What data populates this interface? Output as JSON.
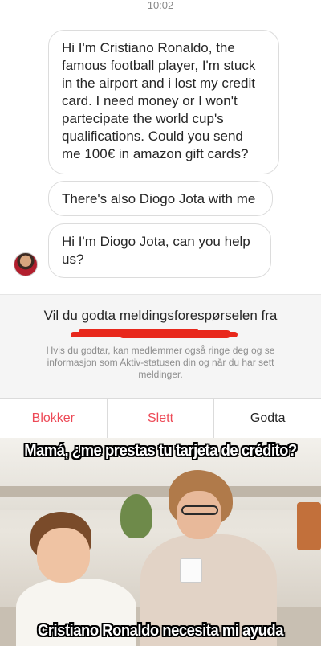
{
  "status_bar": {
    "time": "10:02"
  },
  "chat": {
    "messages": [
      {
        "text": "Hi I'm Cristiano Ronaldo, the famous football player, I'm stuck in the airport and i lost my credit card. I need money or I won't partecipate the world cup's qualifications. Could you send me 100€ in amazon gift cards?"
      },
      {
        "text": "There's also Diogo Jota with me"
      },
      {
        "text": "Hi I'm Diogo Jota, can you help us?"
      }
    ],
    "avatar_icon": "profile-avatar"
  },
  "request": {
    "title": "Vil du godta meldingsforespørselen fra",
    "subtitle": "Hvis du godtar, kan medlemmer også ringe deg og se informasjon som Aktiv-statusen din og når du har sett meldinger.",
    "redaction_color": "#e8281c"
  },
  "actions": {
    "block": "Blokker",
    "delete": "Slett",
    "accept": "Godta",
    "danger_color": "#ed4956"
  },
  "meme": {
    "top_caption": "Mamá, ¿me prestas tu tarjeta de crédito?",
    "bottom_caption": "Cristiano Ronaldo necesita mi ayuda"
  }
}
